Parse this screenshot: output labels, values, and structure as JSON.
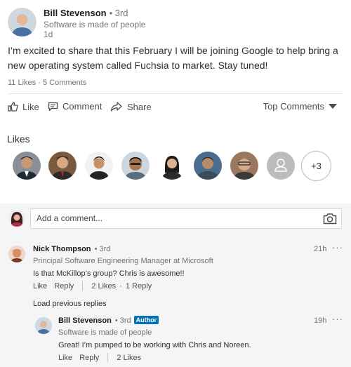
{
  "post": {
    "author_name": "Bill Stevenson",
    "author_degree": "• 3rd",
    "author_headline": "Software is made of people",
    "time": "1d",
    "text": "I’m excited to share that this February I will be joining Google to help bring a new operating system called Fuchsia to market. Stay tuned!",
    "likes_count": "11 Likes",
    "comments_count": "5 Comments",
    "counts_separator": "·"
  },
  "actions": {
    "like": "Like",
    "comment": "Comment",
    "share": "Share",
    "sort": "Top Comments"
  },
  "likes": {
    "title": "Likes",
    "more": "+3"
  },
  "comment_input": {
    "placeholder": "Add a comment..."
  },
  "comments": [
    {
      "name": "Nick Thompson",
      "degree": "• 3rd",
      "headline": "Principal Software Engineering Manager at Microsoft",
      "text": "Is that McKillop’s group? Chris is awesome!!",
      "time": "21h",
      "like": "Like",
      "reply": "Reply",
      "likes": "2 Likes",
      "reply_count": "1 Reply",
      "dot": "·"
    }
  ],
  "load_previous": "Load previous replies",
  "reply": {
    "name": "Bill Stevenson",
    "degree": "• 3rd",
    "badge": "Author",
    "headline": "Software is made of people",
    "text": "Great! I’m pumped to be working with Chris and Noreen.",
    "time": "19h",
    "like": "Like",
    "reply": "Reply",
    "likes": "2 Likes"
  },
  "more_glyph": "···",
  "colors": {
    "accent": "#0073b1",
    "muted": "#737373",
    "comment_bg": "#f3f5f7"
  }
}
